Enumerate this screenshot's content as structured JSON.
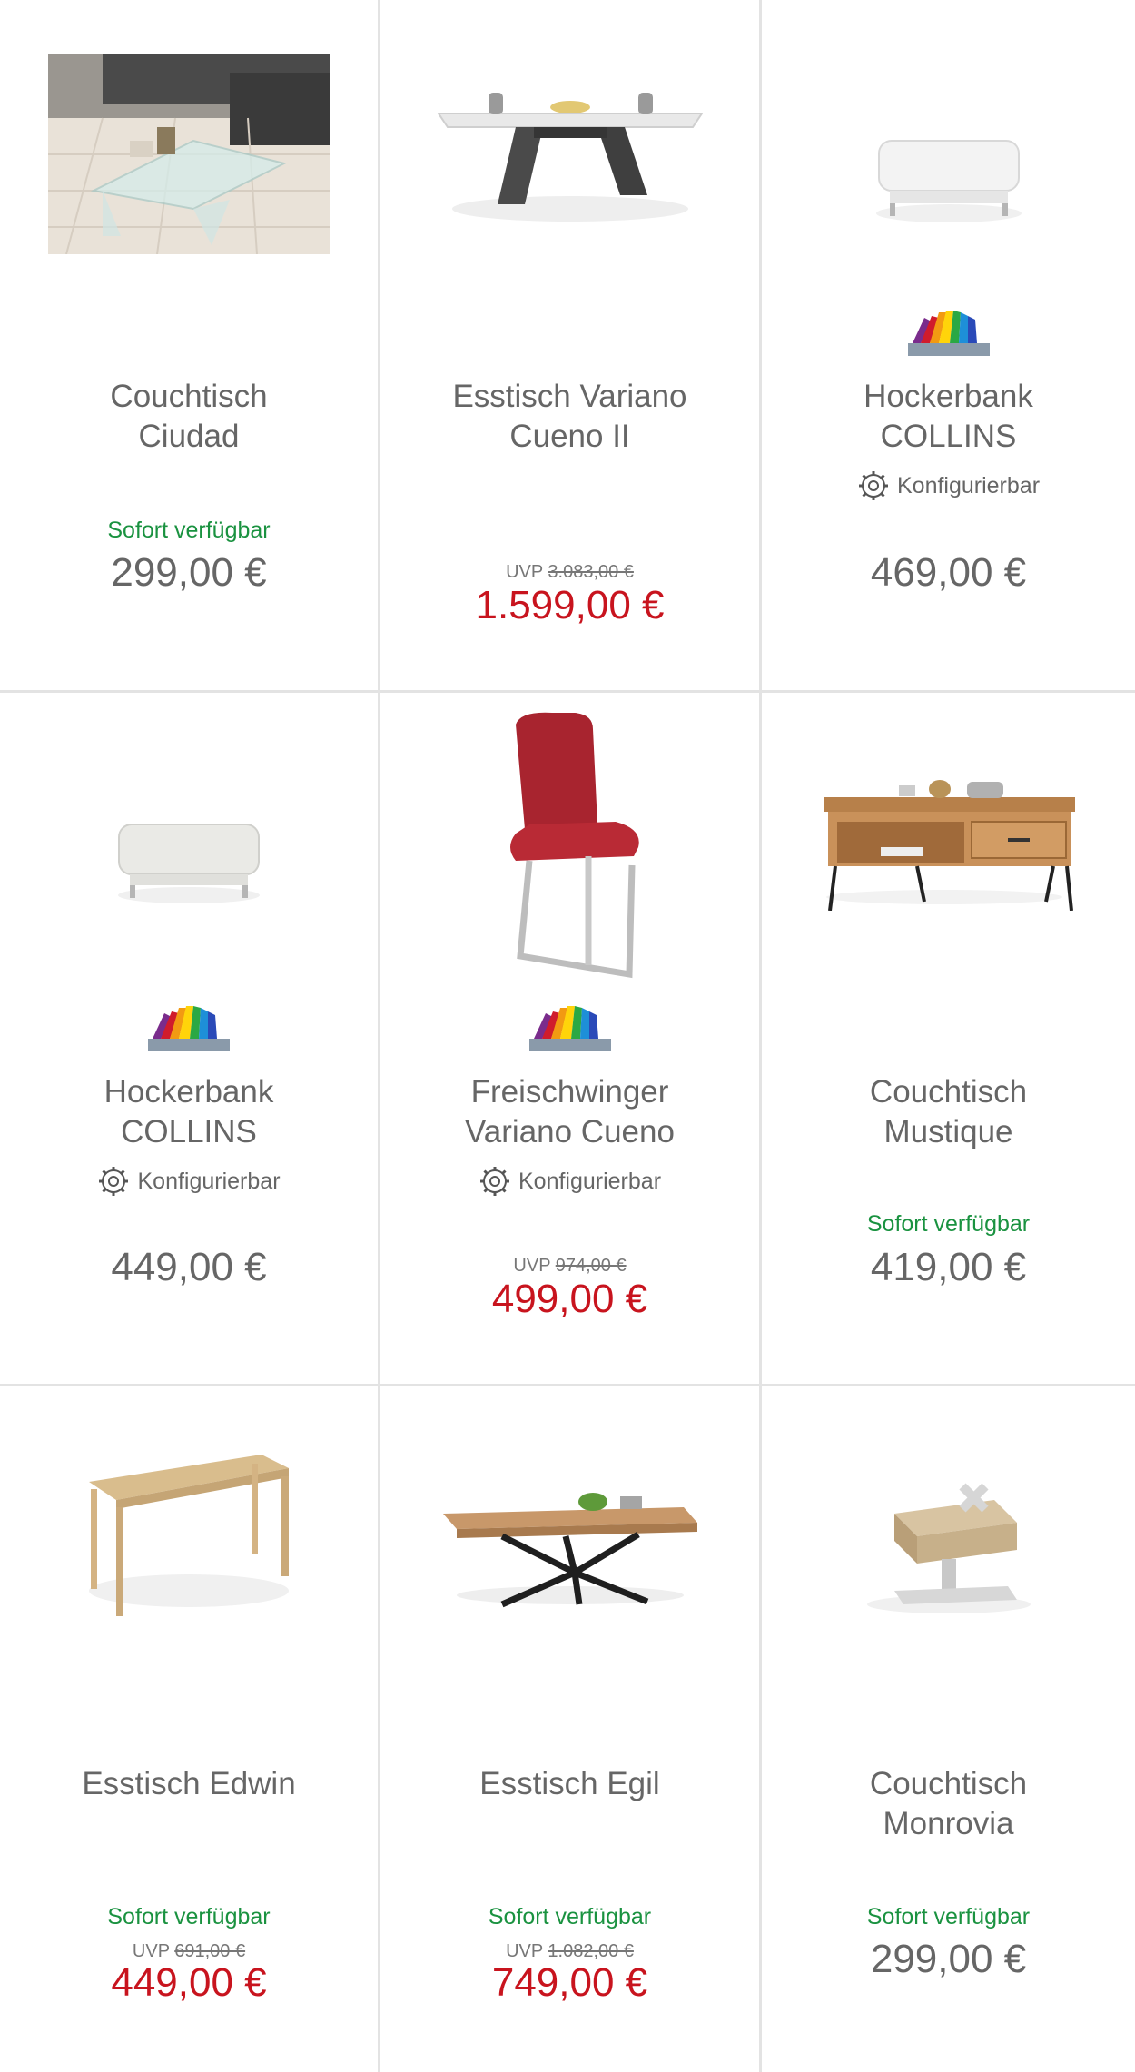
{
  "products": [
    {
      "title_l1": "Couchtisch",
      "title_l2": "Ciudad",
      "availability": "Sofort verfügbar",
      "uvp_label": "",
      "uvp_value": "",
      "price": "299,00 €"
    },
    {
      "title_l1": "Esstisch Variano",
      "title_l2": "Cueno II",
      "availability": "",
      "uvp_label": "UVP",
      "uvp_value": "3.083,00 €",
      "price": "1.599,00 €"
    },
    {
      "title_l1": "Hockerbank",
      "title_l2": "COLLINS",
      "config": "Konfigurierbar",
      "availability": "",
      "uvp_label": "",
      "uvp_value": "",
      "price": "469,00 €"
    },
    {
      "title_l1": "Hockerbank",
      "title_l2": "COLLINS",
      "config": "Konfigurierbar",
      "availability": "",
      "uvp_label": "",
      "uvp_value": "",
      "price": "449,00 €"
    },
    {
      "title_l1": "Freischwinger",
      "title_l2": "Variano Cueno",
      "config": "Konfigurierbar",
      "availability": "",
      "uvp_label": "UVP",
      "uvp_value": "974,00 €",
      "price": "499,00 €"
    },
    {
      "title_l1": "Couchtisch",
      "title_l2": "Mustique",
      "availability": "Sofort verfügbar",
      "uvp_label": "",
      "uvp_value": "",
      "price": "419,00 €"
    },
    {
      "title_l1": "Esstisch Edwin",
      "title_l2": "",
      "availability": "Sofort verfügbar",
      "uvp_label": "UVP",
      "uvp_value": "691,00 €",
      "price": "449,00 €"
    },
    {
      "title_l1": "Esstisch Egil",
      "title_l2": "",
      "availability": "Sofort verfügbar",
      "uvp_label": "UVP",
      "uvp_value": "1.082,00 €",
      "price": "749,00 €"
    },
    {
      "title_l1": "Couchtisch",
      "title_l2": "Monrovia",
      "availability": "Sofort verfügbar",
      "uvp_label": "",
      "uvp_value": "",
      "price": "299,00 €"
    }
  ],
  "colors": {
    "available": "#1a9240",
    "sale_price": "#c8141e",
    "price": "#666666",
    "divider": "#e3e3e3"
  },
  "icons": {
    "config": "gear-icon",
    "color_options": "color-fan-icon"
  }
}
